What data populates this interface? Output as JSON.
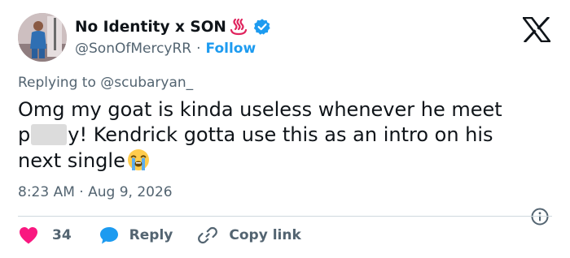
{
  "author": {
    "display_name": "No Identity x SON",
    "handle": "@SonOfMercyRR",
    "separator": "·",
    "follow_label": "Follow",
    "verified_color": "#1d9bf0"
  },
  "reply_context": {
    "prefix": "Replying to",
    "mention": "@scubaryan_"
  },
  "tweet": {
    "line1": "Omg my goat is kinda useless whenever he meet",
    "line2_start": "p",
    "line2_end": "y! Kendrick gotta use this as an intro on his",
    "line3": "next single"
  },
  "meta": {
    "time": "8:23 AM",
    "separator": "·",
    "date": "Aug 9, 2026"
  },
  "actions": {
    "like_count": "34",
    "reply_label": "Reply",
    "copy_link_label": "Copy link"
  },
  "colors": {
    "like": "#f91880",
    "reply": "#1d9bf0",
    "secondary_text": "#536471"
  },
  "icons": [
    "hot-springs-emoji",
    "verified-badge",
    "x-logo",
    "loudly-crying-emoji",
    "info-icon",
    "heart-icon",
    "reply-bubble-icon",
    "link-icon"
  ]
}
